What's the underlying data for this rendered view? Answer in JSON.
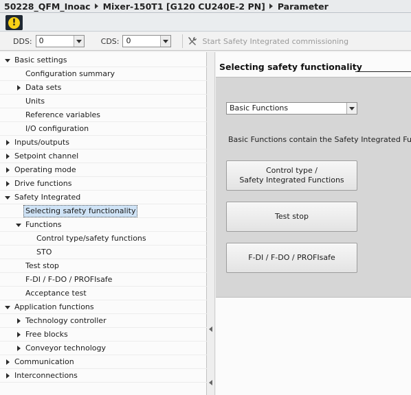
{
  "breadcrumb": {
    "project": "50228_QFM_Inoac",
    "device": "Mixer-150T1 [G120 CU240E-2 PN]",
    "page": "Parameter"
  },
  "toolbar": {
    "dds_label": "DDS:",
    "dds_value": "0",
    "cds_label": "CDS:",
    "cds_value": "0",
    "commission_label": "Start Safety Integrated commissioning"
  },
  "warning_icon": {
    "glyph": "!",
    "color": "#f7d117"
  },
  "tree": [
    {
      "label": "Basic settings",
      "level": 0,
      "toggle": "expanded"
    },
    {
      "label": "Configuration summary",
      "level": 1,
      "toggle": "none"
    },
    {
      "label": "Data sets",
      "level": 1,
      "toggle": "collapsed"
    },
    {
      "label": "Units",
      "level": 1,
      "toggle": "none"
    },
    {
      "label": "Reference variables",
      "level": 1,
      "toggle": "none"
    },
    {
      "label": "I/O configuration",
      "level": 1,
      "toggle": "none"
    },
    {
      "label": "Inputs/outputs",
      "level": 0,
      "toggle": "collapsed"
    },
    {
      "label": "Setpoint channel",
      "level": 0,
      "toggle": "collapsed"
    },
    {
      "label": "Operating mode",
      "level": 0,
      "toggle": "collapsed"
    },
    {
      "label": "Drive functions",
      "level": 0,
      "toggle": "collapsed"
    },
    {
      "label": "Safety Integrated",
      "level": 0,
      "toggle": "expanded"
    },
    {
      "label": "Selecting safety functionality",
      "level": 1,
      "toggle": "none",
      "selected": true
    },
    {
      "label": "Functions",
      "level": 1,
      "toggle": "expanded"
    },
    {
      "label": "Control type/safety functions",
      "level": 2,
      "toggle": "none"
    },
    {
      "label": "STO",
      "level": 2,
      "toggle": "none"
    },
    {
      "label": "Test stop",
      "level": 1,
      "toggle": "none"
    },
    {
      "label": "F-DI / F-DO / PROFIsafe",
      "level": 1,
      "toggle": "none"
    },
    {
      "label": "Acceptance test",
      "level": 1,
      "toggle": "none"
    },
    {
      "label": "Application functions",
      "level": 0,
      "toggle": "expanded"
    },
    {
      "label": "Technology controller",
      "level": 1,
      "toggle": "collapsed"
    },
    {
      "label": "Free blocks",
      "level": 1,
      "toggle": "collapsed"
    },
    {
      "label": "Conveyor technology",
      "level": 1,
      "toggle": "collapsed"
    },
    {
      "label": "Communication",
      "level": 0,
      "toggle": "collapsed"
    },
    {
      "label": "Interconnections",
      "level": 0,
      "toggle": "collapsed"
    }
  ],
  "content": {
    "title": "Selecting safety functionality",
    "function_select": "Basic Functions",
    "description": "Basic Functions contain the Safety Integrated Fur",
    "buttons": {
      "control_type_line1": "Control type /",
      "control_type_line2": "Safety Integrated Functions",
      "test_stop": "Test stop",
      "fdi": "F-DI / F-DO / PROFIsafe"
    }
  }
}
